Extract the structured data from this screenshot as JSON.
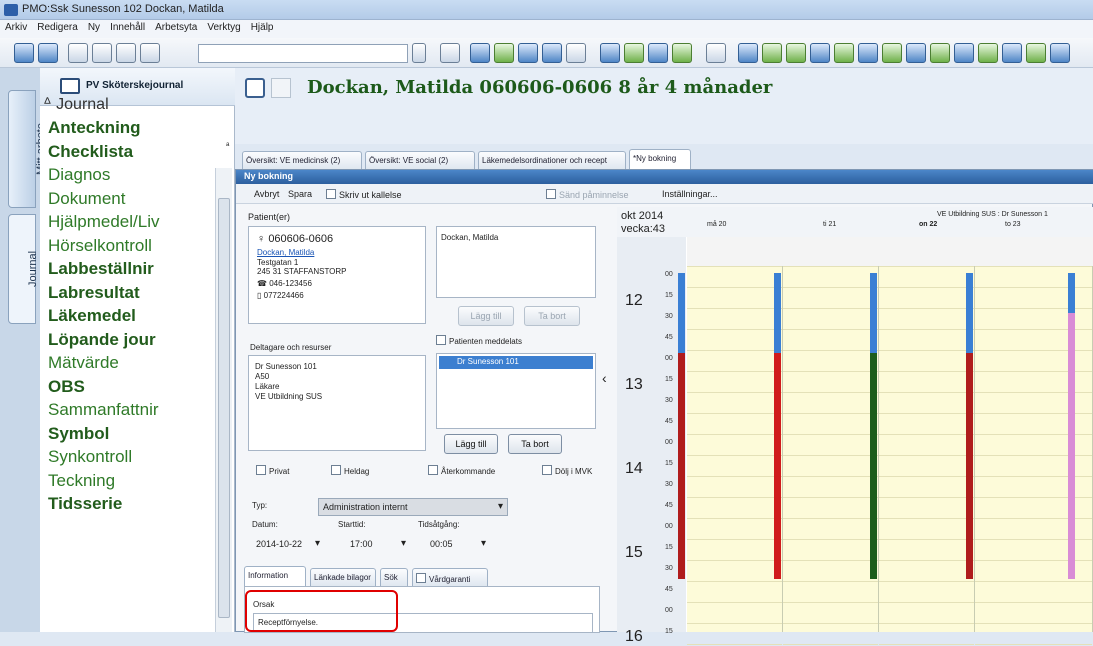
{
  "window": {
    "title": "PMO:Ssk Sunesson 102 Dockan, Matilda"
  },
  "menu": [
    "Arkiv",
    "Redigera",
    "Ny",
    "Innehåll",
    "Arbetsyta",
    "Verktyg",
    "Hjälp"
  ],
  "left_tabs": [
    "Mitt arbete",
    "Journal"
  ],
  "left_panel": {
    "header": "PV Sköterskejournal",
    "root": "Journal",
    "items": [
      {
        "label": "Anteckning",
        "bold": true
      },
      {
        "label": "Checklista",
        "bold": true
      },
      {
        "label": "Diagnos",
        "bold": false
      },
      {
        "label": "Dokument",
        "bold": false
      },
      {
        "label": "Hjälpmedel/Liv",
        "bold": false
      },
      {
        "label": "Hörselkontroll",
        "bold": false
      },
      {
        "label": "Labbeställnir",
        "bold": true
      },
      {
        "label": "Labresultat",
        "bold": true
      },
      {
        "label": "Läkemedel",
        "bold": true
      },
      {
        "label": "Löpande jour",
        "bold": true
      },
      {
        "label": "Mätvärde",
        "bold": false
      },
      {
        "label": "OBS",
        "bold": true
      },
      {
        "label": "Sammanfattnir",
        "bold": false
      },
      {
        "label": "Symbol",
        "bold": true
      },
      {
        "label": "Synkontroll",
        "bold": false
      },
      {
        "label": "Teckning",
        "bold": false
      },
      {
        "label": "Tidsserie",
        "bold": true
      }
    ]
  },
  "patient": {
    "header": "Dockan, Matilda  060606-0606  8 år 4 månader"
  },
  "doc_tabs": [
    "Översikt: VE medicinsk (2)",
    "Översikt: VE social (2)",
    "Läkemedelsordinationer och recept",
    "*Ny bokning"
  ],
  "dialog": {
    "title": "Ny bokning",
    "toolbar": {
      "cancel": "Avbryt",
      "save": "Spara",
      "print": "Skriv ut kallelse",
      "reminder": "Sänd påminnelse",
      "settings": "Inställningar..."
    },
    "patients_label": "Patient(er)",
    "patient_card": {
      "pnr": "060606-0606",
      "name_link": "Dockan, Matilda",
      "address1": "Testgatan 1",
      "address2": "245 31 STAFFANSTORP",
      "phone": "046-123456",
      "mobile": "077224466"
    },
    "patient_list_item": "Dockan, Matilda",
    "add_label": "Lägg till",
    "remove_label": "Ta bort",
    "notified_label": "Patienten meddelats",
    "participants_label": "Deltagare och resurser",
    "participant_lines": [
      "Dr Sunesson 101",
      "A50",
      "Läkare",
      "VE Utbildning SUS"
    ],
    "participant_selected": "Dr Sunesson 101",
    "checks": [
      "Privat",
      "Heldag",
      "Återkommande",
      "Dölj i MVK"
    ],
    "type_label": "Typ:",
    "type_value": "Administration internt",
    "date_label": "Datum:",
    "date_value": "2014-10-22",
    "start_label": "Starttid:",
    "start_value": "17:00",
    "duration_label": "Tidsåtgång:",
    "duration_value": "00:05",
    "bottom_tabs": [
      "Information",
      "Länkade bilagor",
      "Sök",
      "Vårdgaranti"
    ],
    "reason_label": "Orsak",
    "reason_value": "Receptförnyelse."
  },
  "calendar": {
    "month": "okt 2014",
    "week": "vecka:43",
    "resource": "VE Utbildning SUS : Dr Sunesson 1",
    "days": [
      "må 20",
      "ti 21",
      "on 22",
      "to 23"
    ],
    "hours": [
      "12",
      "13",
      "14",
      "15",
      "16"
    ],
    "minutes": [
      "00",
      "15",
      "30",
      "45"
    ]
  }
}
